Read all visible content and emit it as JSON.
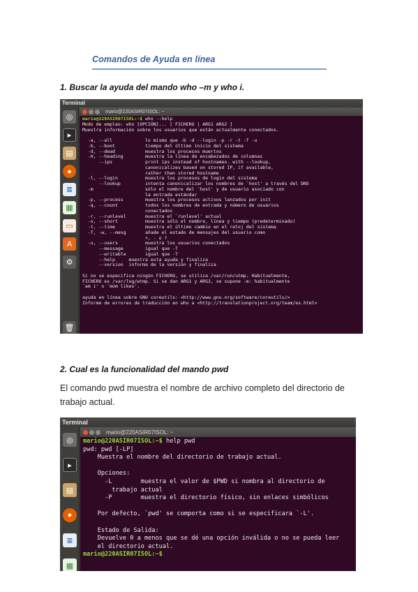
{
  "header": {
    "title": "Comandos de Ayuda en línea"
  },
  "section1": {
    "heading": "1. Buscar la ayuda del mando who –m y who i."
  },
  "section2": {
    "heading": "2. Cual es la funcionalidad del mando pwd",
    "paragraph": "El comando pwd muestra el nombre de archivo completo del directorio de trabajo actual."
  },
  "screenshot1": {
    "app_title": "Terminal",
    "window_title": "mario@220ASIR07ISOL: ~",
    "prompt": "mario@220ASIR07ISOL:~$",
    "command": " who --help",
    "output": [
      "Modo de empleo: who [OPCIÓN]... [ FICHERO | ARG1 ARG2 ]",
      "Muestra información sobre los usuarios que están actualmente conectados.",
      "",
      "  -a, --all            lo mismo que -b -d --login -p -r -t -T -u",
      "  -b, --boot           tiempo del último inicio del sistema",
      "  -d, --dead           muestra los procesos muertos",
      "  -H, --heading        muestra la línea de encabezados de columnas",
      "      --ips            print ips instead of hostnames. with --lookup,",
      "                       canonicalizes based on stored IP, if available,",
      "                       rather than stored hostname",
      "  -l, --login          muestra los procesos de login del sistema",
      "      --lookup         intenta canonicalizar los nombres de `host' a través del DNS",
      "  -m                   sólo el nombre del `host' y de usuario asociado con",
      "                       la entrada estándar",
      "  -p, --process        muestra los procesos activos lanzados por init",
      "  -q, --count          todos los nombres de entrada y número de usuarios",
      "                       conectados",
      "  -r, --runlevel       muestra el `runlevel' actual",
      "  -s, --short          muestra sólo el nombre, línea y tiempo (predeterminado)",
      "  -t, --time           muestra el último cambio en el reloj del sistema",
      "  -T, -w, --mesg       añade el estado de mensajes del usuario como",
      "                       +, - o ?",
      "  -u, --users          muestra los usuarios conectados",
      "      --message        igual que -T",
      "      --writable       igual que -T",
      "      --help     muestra esta ayuda y finaliza",
      "      --version  informa de la versión y finaliza",
      "",
      "Si no se especifica ningún FICHERO, se utiliza /var/run/utmp. Habitualmente,",
      "FICHERO es /var/log/wtmp. Si se dan ARG1 y ARG2, se supone -m: habitualmente",
      "`am i' o `mom likes'.",
      "",
      "ayuda en línea sobre GNU coreutils: <http://www.gnu.org/software/coreutils/>",
      "Informe de errores de traducción en who a <http://translationproject.org/team/es.html>"
    ]
  },
  "screenshot2": {
    "app_title": "Terminal",
    "window_title": "mario@220ASIR07ISOL: ~",
    "prompt": "mario@220ASIR07ISOL:~$",
    "command": " help pwd",
    "output": [
      "pwd: pwd [-LP]",
      "    Muestra el nombre del directorio de trabajo actual.",
      "",
      "    Opciones:",
      "      -L        muestra el valor de $PWD si nombra al directorio de",
      "        trabajo actual",
      "      -P        muestra el directorio físico, sin enlaces simbólicos",
      "",
      "    Por defecto, `pwd' se comporta como si se especificara `-L'.",
      "",
      "    Estado de Salida:",
      "    Devuelve 0 a menos que se dé una opción inválida o no se pueda leer",
      "    el directorio actual."
    ],
    "final_prompt": "mario@220ASIR07ISOL:~$"
  },
  "colors": {
    "terminal_bg": "#300a24",
    "prompt": "#8ae234",
    "header_title": "#3a5f9c"
  },
  "launcher_icons": [
    "dash-icon",
    "terminal-icon",
    "files-icon",
    "firefox-icon",
    "writer-icon",
    "calc-icon",
    "impress-icon",
    "software-center-icon",
    "settings-icon",
    "trash-icon"
  ]
}
